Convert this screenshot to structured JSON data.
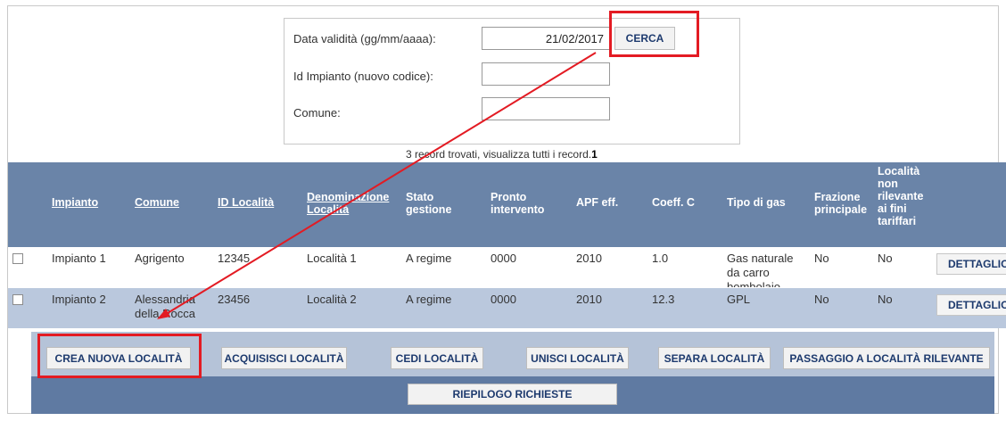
{
  "search": {
    "date_label": "Data validità (gg/mm/aaaa):",
    "date_value": "21/02/2017",
    "impianto_label": "Id Impianto (nuovo codice):",
    "impianto_value": "",
    "comune_label": "Comune:",
    "comune_value": "",
    "search_button": "CERCA"
  },
  "records": {
    "text": "3 record trovati, visualizza tutti i record.",
    "page": "1"
  },
  "table": {
    "headers": [
      "Impianto",
      "Comune",
      "ID Località",
      "Denominazione Località",
      "Stato gestione",
      "Pronto intervento",
      "APF eff.",
      "Coeff. C",
      "Tipo di gas",
      "Frazione principale",
      "Località non rilevante ai fini tariffari"
    ],
    "rows": [
      {
        "impianto": "Impianto 1",
        "comune": "Agrigento",
        "id_localita": "12345",
        "denominazione": "Località 1",
        "stato": "A regime",
        "pronto": "0000",
        "apf": "2010",
        "coeff": "1.0",
        "tipo_gas": "Gas naturale da carro bombolaio",
        "frazione": "No",
        "non_rilevante": "No",
        "action": "DETTAGLIO"
      },
      {
        "impianto": "Impianto 2",
        "comune": "Alessandria della Rocca",
        "id_localita": "23456",
        "denominazione": "Località 2",
        "stato": "A regime",
        "pronto": "0000",
        "apf": "2010",
        "coeff": "12.3",
        "tipo_gas": "GPL",
        "frazione": "No",
        "non_rilevante": "No",
        "action": "DETTAGLIO"
      }
    ]
  },
  "actions": {
    "crea": "CREA NUOVA LOCALITÀ",
    "acquisisci": "ACQUISISCI LOCALITÀ",
    "cedi": "CEDI LOCALITÀ",
    "unisci": "UNISCI LOCALITÀ",
    "separa": "SEPARA LOCALITÀ",
    "passaggio": "PASSAGGIO A LOCALITÀ RILEVANTE",
    "riepilogo": "RIEPILOGO RICHIESTE"
  },
  "colors": {
    "header_bg": "#6a84a8",
    "row_alt_bg": "#bac8dd",
    "highlight": "#e31b23",
    "button_text": "#1d3a6e"
  }
}
